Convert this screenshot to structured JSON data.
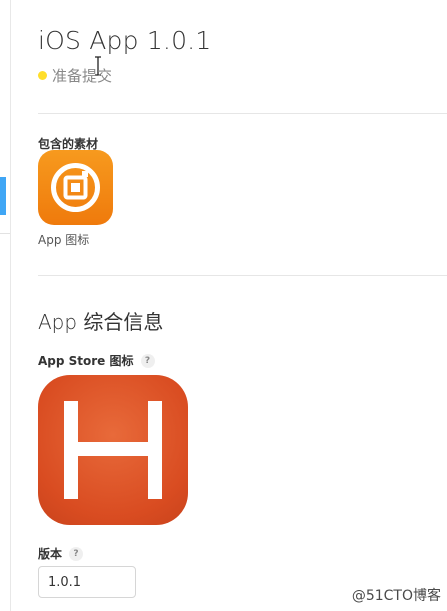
{
  "header": {
    "title": "iOS App 1.0.1",
    "status": {
      "text": "准备提交",
      "color": "#ffde2b"
    }
  },
  "assets": {
    "label": "包含的素材",
    "app_icon": {
      "caption": "App 图标",
      "color": "#f28a14",
      "icon_name": "app-icon-orange-square-logo"
    }
  },
  "general_info": {
    "title": "App 综合信息",
    "app_store_icon": {
      "label": "App Store 图标",
      "help": "?",
      "color": "#d94c21",
      "icon_name": "app-store-icon-h-logo"
    },
    "version": {
      "label": "版本",
      "help": "?",
      "value": "1.0.1"
    }
  },
  "watermark": "@51CTO博客"
}
